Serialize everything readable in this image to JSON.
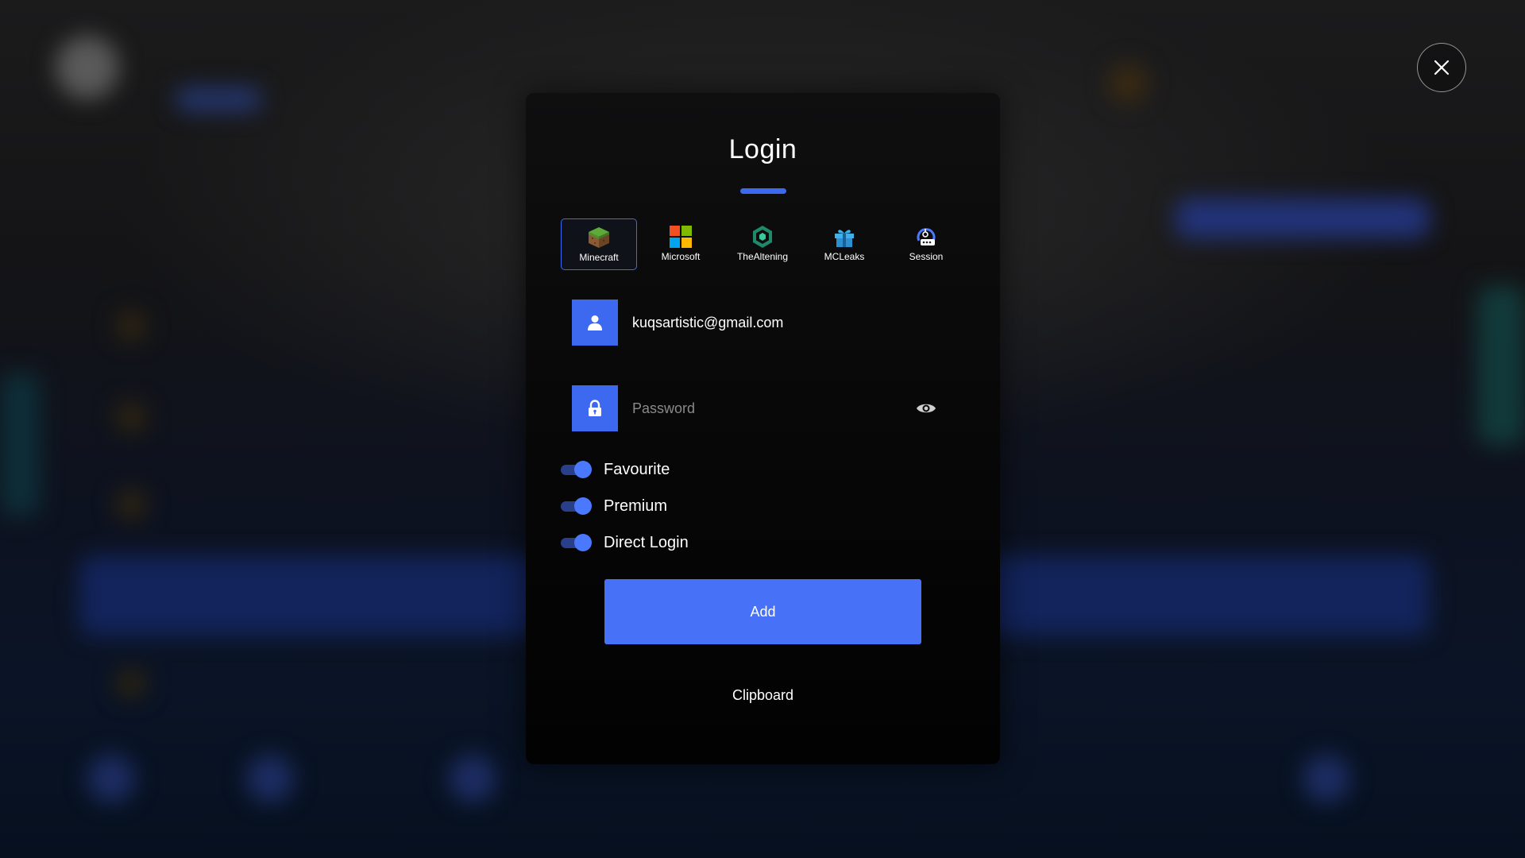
{
  "dialog": {
    "title": "Login",
    "close_icon": "close-icon"
  },
  "account_types": [
    {
      "label": "Minecraft",
      "icon": "grass-block-icon",
      "active": true
    },
    {
      "label": "Microsoft",
      "icon": "microsoft-logo-icon",
      "active": false
    },
    {
      "label": "TheAltening",
      "icon": "thealtening-hexagon-icon",
      "active": false
    },
    {
      "label": "MCLeaks",
      "icon": "gift-icon",
      "active": false
    },
    {
      "label": "Session",
      "icon": "session-token-icon",
      "active": false
    }
  ],
  "fields": {
    "email": {
      "value": "kuqsartistic@gmail.com",
      "icon": "user-icon"
    },
    "password": {
      "placeholder": "Password",
      "icon": "lock-icon",
      "toggle_icon": "eye-icon"
    }
  },
  "toggles": [
    {
      "label": "Favourite",
      "on": true
    },
    {
      "label": "Premium",
      "on": true
    },
    {
      "label": "Direct Login",
      "on": true
    }
  ],
  "actions": {
    "add_label": "Add",
    "clipboard_label": "Clipboard"
  },
  "colors": {
    "accent": "#3d68f0",
    "button": "#4771f6",
    "dialog_bg": "#0a0a0a"
  }
}
